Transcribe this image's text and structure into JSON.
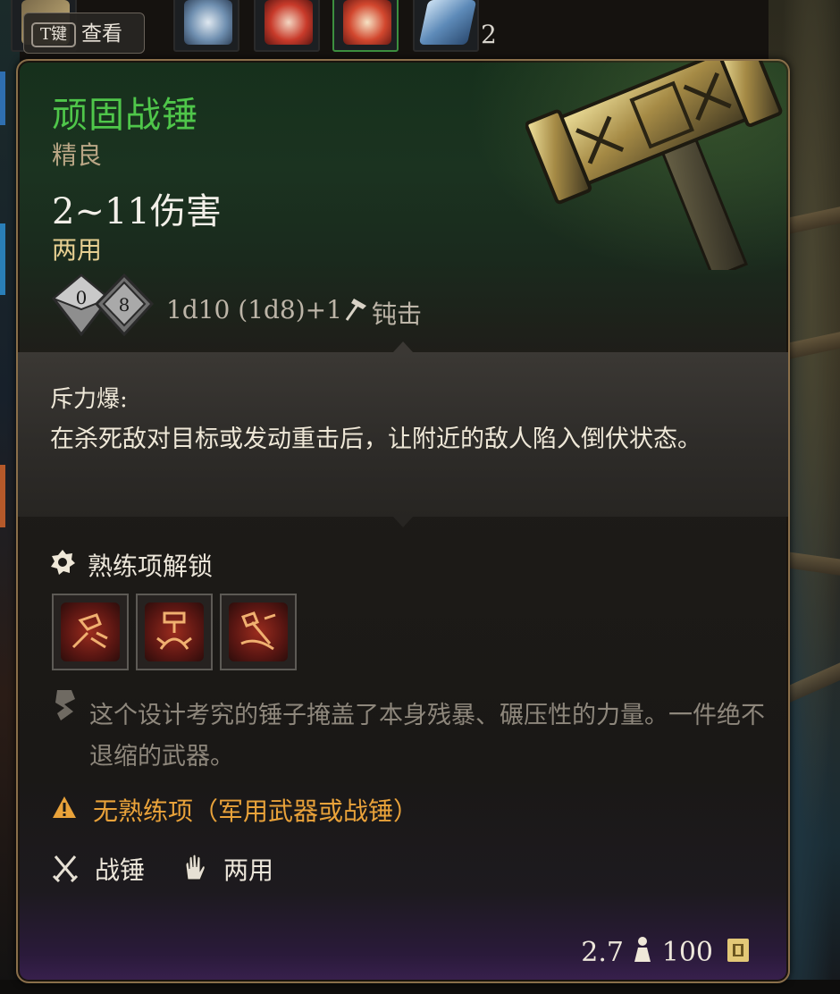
{
  "hotbar": {
    "key_hint": {
      "key": "T键",
      "label": "查看"
    },
    "stack_count": "2"
  },
  "item": {
    "name": "顽固战锤",
    "rarity": "精良",
    "damage": "2~11伤害",
    "handedness": "两用",
    "dice": [
      "0",
      "8"
    ],
    "dice_formula": "1d10 (1d8)+1",
    "damage_type": "钝击",
    "ability": {
      "title": "斥力爆:",
      "description": "在杀死敌对目标或发动重击后，让附近的敌人陷入倒伏状态。"
    },
    "proficiency": {
      "header": "熟练项解锁",
      "skills": [
        "weapon-action-1",
        "weapon-action-2",
        "weapon-action-3"
      ]
    },
    "flavor": "这个设计考究的锤子掩盖了本身残暴、碾压性的力量。一件绝不退缩的武器。",
    "warning": "无熟练项（军用武器或战锤）",
    "properties": [
      {
        "icon": "crossed-weapons-icon",
        "label": "战锤"
      },
      {
        "icon": "hand-icon",
        "label": "两用"
      }
    ],
    "weight": "2.7",
    "value": "100"
  },
  "colors": {
    "name": "#4fc64a",
    "rarity": "#b9a685",
    "handedness": "#e6cf91",
    "warning": "#e9a23a",
    "flavor": "#8e877c",
    "border": "#8a6f4a"
  }
}
